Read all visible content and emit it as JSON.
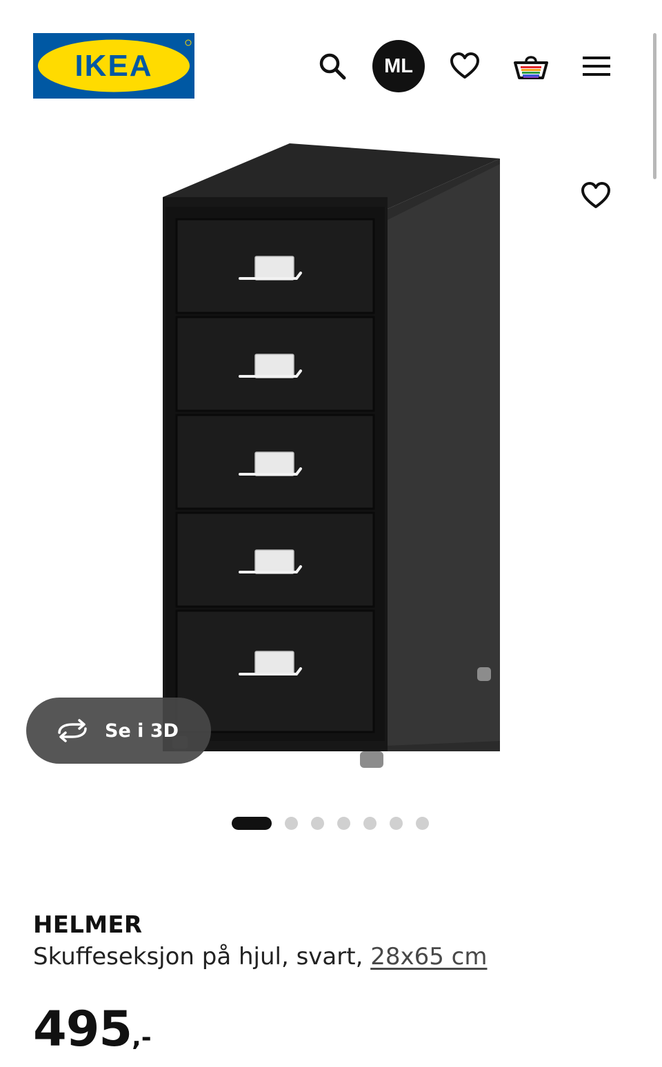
{
  "header": {
    "logo_text": "IKEA",
    "search_icon": "search-icon",
    "avatar_initials": "ML",
    "favorites_icon": "heart-icon",
    "cart_icon": "shopping-basket-icon",
    "menu_icon": "hamburger-menu-icon",
    "colors": {
      "brand_blue": "#0058a3",
      "brand_yellow": "#ffdb00",
      "avatar_bg": "#111111"
    }
  },
  "gallery": {
    "image_icon": "helmer-drawer-unit-image",
    "view_3d_label": "Se i 3D",
    "view_3d_icon": "rotate-3d-icon",
    "dots_total": 7,
    "active_dot": 1,
    "product_favorite_icon": "heart-outline-icon"
  },
  "product": {
    "name": "HELMER",
    "description": "Skuffeseksjon på hjul, svart, ",
    "size_link": "28x65 cm",
    "price": "495",
    "price_suffix": ",-"
  }
}
